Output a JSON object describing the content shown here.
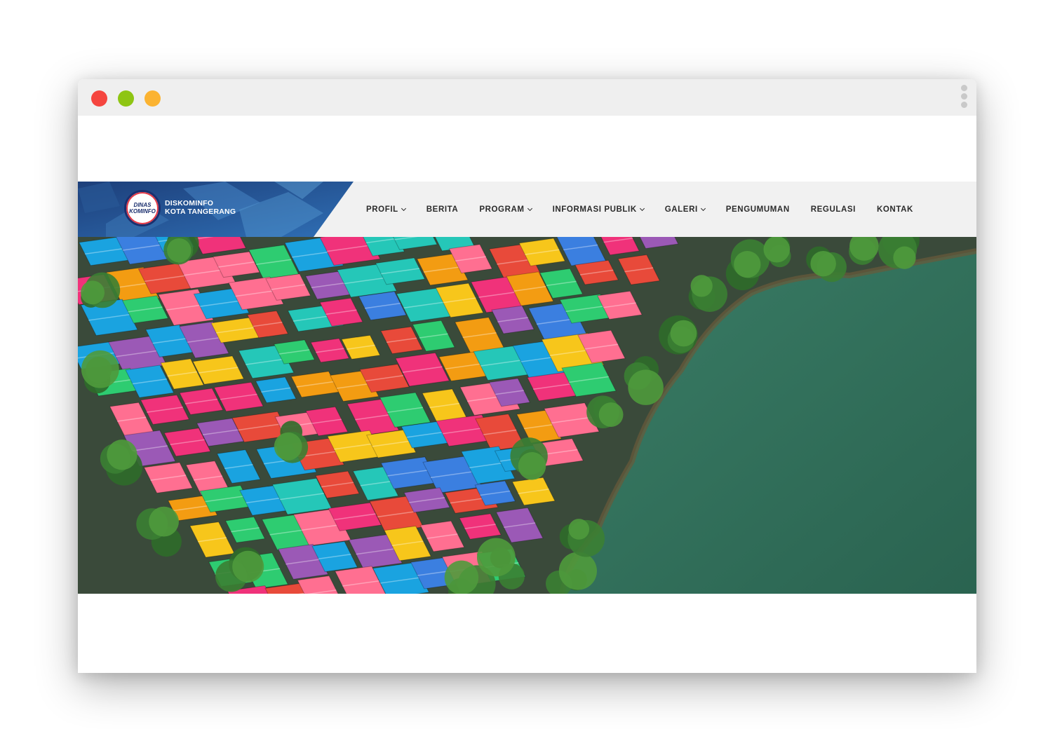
{
  "window": {
    "controls": {
      "close_color": "#f5453f",
      "minimize_color": "#8ec513",
      "maximize_color": "#fbb331"
    }
  },
  "site": {
    "logo_badge": [
      "DINAS",
      "KOMINFO"
    ],
    "logo_text_line1": "DISKOMINFO",
    "logo_text_line2": "KOTA TANGERANG"
  },
  "nav": {
    "items": [
      {
        "label": "PROFIL",
        "dropdown": true
      },
      {
        "label": "BERITA",
        "dropdown": false
      },
      {
        "label": "PROGRAM",
        "dropdown": true
      },
      {
        "label": "INFORMASI PUBLIK",
        "dropdown": true
      },
      {
        "label": "GALERI",
        "dropdown": true
      },
      {
        "label": "PENGUMUMAN",
        "dropdown": false
      },
      {
        "label": "REGULASI",
        "dropdown": false
      },
      {
        "label": "KONTAK",
        "dropdown": false
      }
    ]
  },
  "hero": {
    "image": "aerial-colorful-village-by-lake",
    "water_color": "#2f6b56",
    "roof_colors": [
      "#1aa3e0",
      "#f0327a",
      "#f7c61b",
      "#25c7b8",
      "#e84a3a",
      "#9b59b6",
      "#f39c12",
      "#2ecc71",
      "#3b7fe0",
      "#ff6f91"
    ]
  }
}
